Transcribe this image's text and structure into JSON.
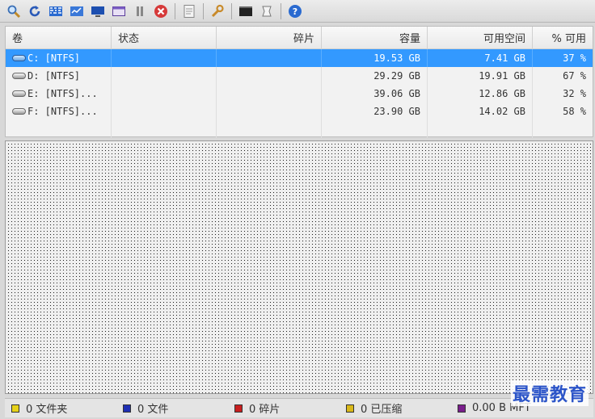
{
  "toolbar": {
    "icons": [
      "search-icon",
      "refresh-icon",
      "defrag-icon",
      "analyze-icon",
      "monitor-icon",
      "window-icon",
      "pause-icon",
      "stop-icon",
      "report-icon",
      "settings-icon",
      "console-icon",
      "script-icon",
      "help-icon"
    ]
  },
  "volumes": {
    "headers": [
      "卷",
      "状态",
      "碎片",
      "容量",
      "可用空间",
      "% 可用"
    ],
    "rows": [
      {
        "name": "C: [NTFS]",
        "status": "",
        "fragmentation": "",
        "capacity": "19.53 GB",
        "free": "7.41 GB",
        "percent": "37 %",
        "selected": true
      },
      {
        "name": "D: [NTFS]",
        "status": "",
        "fragmentation": "",
        "capacity": "29.29 GB",
        "free": "19.91 GB",
        "percent": "67 %",
        "selected": false
      },
      {
        "name": "E: [NTFS]...",
        "status": "",
        "fragmentation": "",
        "capacity": "39.06 GB",
        "free": "12.86 GB",
        "percent": "32 %",
        "selected": false
      },
      {
        "name": "F: [NTFS]...",
        "status": "",
        "fragmentation": "",
        "capacity": "23.90 GB",
        "free": "14.02 GB",
        "percent": "58 %",
        "selected": false
      }
    ]
  },
  "legend": [
    {
      "label": "0 文件夹",
      "color": "#e6d21a"
    },
    {
      "label": "0 文件",
      "color": "#1f2fb4"
    },
    {
      "label": "0 碎片",
      "color": "#c81e1e"
    },
    {
      "label": "0 已压缩",
      "color": "#d9b81a"
    },
    {
      "label": "0.00 B MFT",
      "color": "#7a1e8c"
    }
  ],
  "watermark": "最需教育"
}
